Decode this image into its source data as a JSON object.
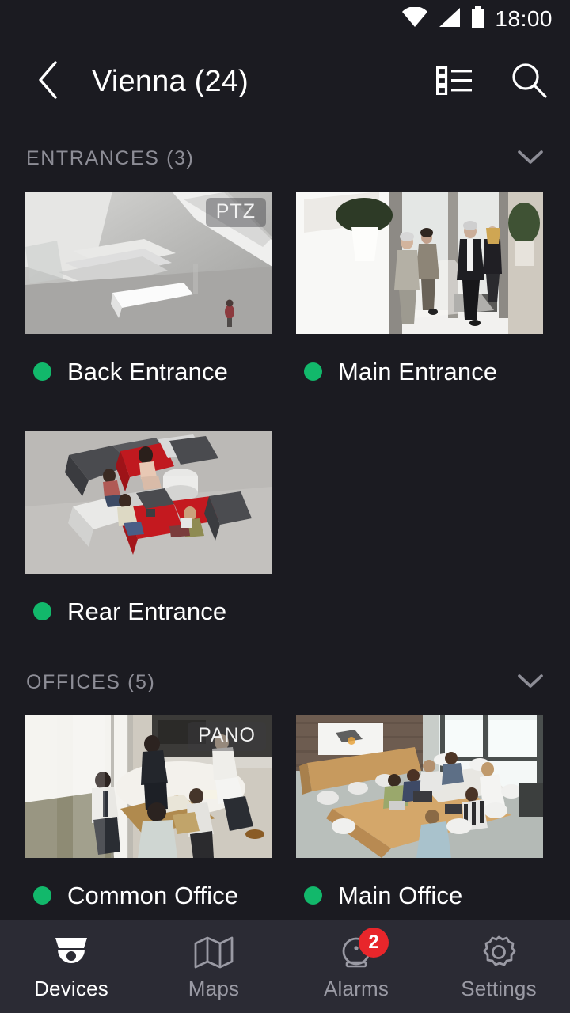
{
  "status_bar": {
    "time": "18:00",
    "icons": [
      "wifi-icon",
      "cellular-signal-icon",
      "battery-icon"
    ]
  },
  "app_bar": {
    "back_icon": "chevron-left-icon",
    "title": "Vienna (24)",
    "list_view_icon": "list-view-icon",
    "search_icon": "search-icon"
  },
  "colors": {
    "page_background": "#1b1b21",
    "nav_background": "#2b2b34",
    "status_online": "#12b86b",
    "alarm_badge": "#e8262b",
    "section_text": "#8d8d96",
    "primary_text": "#ffffff"
  },
  "sections": [
    {
      "title": "ENTRANCES (3)",
      "collapse_icon": "chevron-down-icon",
      "cameras": [
        {
          "name": "Back Entrance",
          "badge": "PTZ",
          "status": "online",
          "thumbnail": "escalator-lobby-thumbnail"
        },
        {
          "name": "Main Entrance",
          "badge": "",
          "status": "online",
          "thumbnail": "people-walking-lobby-thumbnail"
        },
        {
          "name": "Rear Entrance",
          "badge": "",
          "status": "online",
          "thumbnail": "lounge-seating-thumbnail"
        }
      ]
    },
    {
      "title": "OFFICES (5)",
      "collapse_icon": "chevron-down-icon",
      "cameras": [
        {
          "name": "Common Office",
          "badge": "PANO",
          "status": "online",
          "thumbnail": "meeting-room-standing-thumbnail"
        },
        {
          "name": "Main Office",
          "badge": "",
          "status": "online",
          "thumbnail": "conference-table-thumbnail"
        }
      ]
    }
  ],
  "bottom_nav": {
    "items": [
      {
        "label": "Devices",
        "icon": "dome-camera-icon",
        "active": true,
        "badge": ""
      },
      {
        "label": "Maps",
        "icon": "map-icon",
        "active": false,
        "badge": ""
      },
      {
        "label": "Alarms",
        "icon": "alarm-bell-icon",
        "active": false,
        "badge": "2"
      },
      {
        "label": "Settings",
        "icon": "gear-icon",
        "active": false,
        "badge": ""
      }
    ]
  }
}
